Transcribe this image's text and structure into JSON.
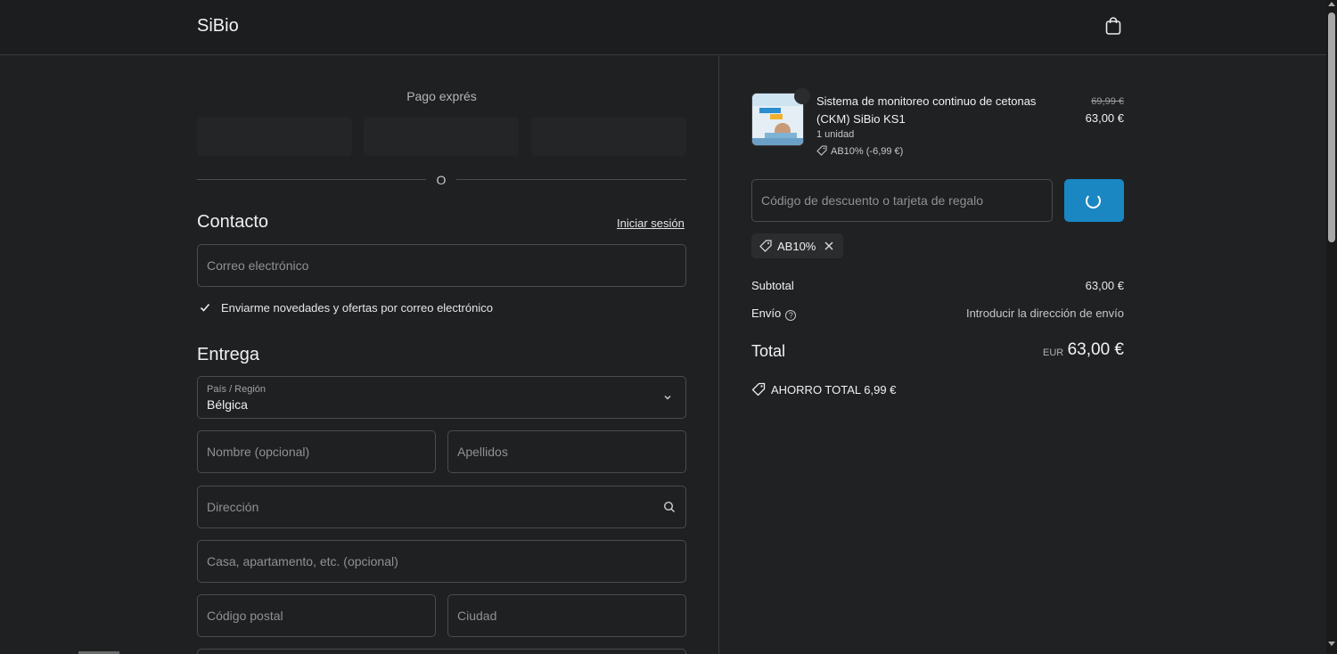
{
  "header": {
    "brand": "SiBio",
    "cart_icon": "shopping-bag-icon"
  },
  "express": {
    "title": "Pago exprés",
    "separator": "O"
  },
  "contact": {
    "title": "Contacto",
    "login_link": "Iniciar sesión",
    "email_placeholder": "Correo electrónico",
    "newsletter_label": "Enviarme novedades y ofertas por correo electrónico",
    "newsletter_checked": true
  },
  "delivery": {
    "title": "Entrega",
    "country_label": "País / Región",
    "country_value": "Bélgica",
    "first_name_placeholder": "Nombre (opcional)",
    "last_name_placeholder": "Apellidos",
    "address_placeholder": "Dirección",
    "apartment_placeholder": "Casa, apartamento, etc. (opcional)",
    "postal_placeholder": "Código postal",
    "city_placeholder": "Ciudad"
  },
  "order": {
    "product": {
      "name": "Sistema de monitoreo continuo de cetonas (CKM) SiBio KS1",
      "quantity": "1 unidad",
      "discount": "AB10% (-6,99 €)",
      "old_price": "69,99 €",
      "price": "63,00 €"
    },
    "discount_placeholder": "Código de descuento o tarjeta de regalo",
    "applied_code": "AB10%",
    "subtotal_label": "Subtotal",
    "subtotal_value": "63,00 €",
    "shipping_label": "Envío",
    "shipping_value": "Introducir la dirección de envío",
    "total_label": "Total",
    "total_currency": "EUR",
    "total_value": "63,00 €",
    "savings": "AHORRO TOTAL  6,99 €"
  },
  "colors": {
    "accent": "#1a87c2",
    "background": "#1e2022"
  }
}
